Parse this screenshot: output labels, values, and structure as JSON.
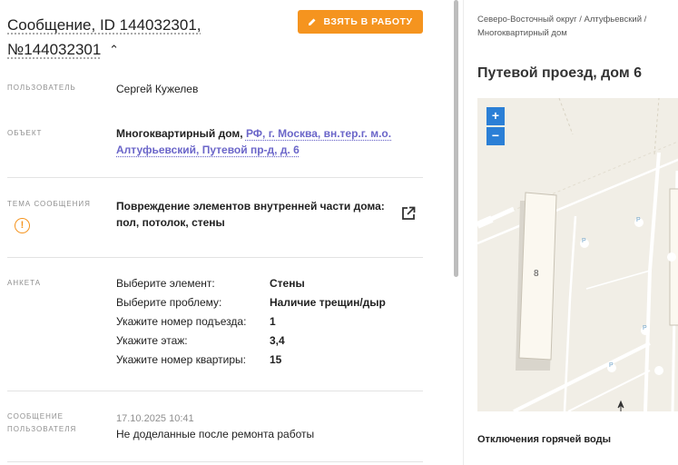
{
  "header": {
    "title_line1": "Сообщение, ID 144032301,",
    "title_line2": "№144032301",
    "chevron": "^",
    "take_button_label": "ВЗЯТЬ В РАБОТУ"
  },
  "fields": {
    "user_label": "ПОЛЬЗОВАТЕЛЬ",
    "user_value": "Сергей Кужелев",
    "object_label": "ОБЪЕКТ",
    "object_prefix": "Многоквартирный дом,",
    "object_link_line1": "РФ, г. Москва, вн.тер.г. м.о.",
    "object_link_line2": "Алтуфьевский, Путевой пр-д, д. 6",
    "topic_label": "ТЕМА СООБЩЕНИЯ",
    "topic_line1": "Повреждение элементов внутренней части дома:",
    "topic_line2": "пол, потолок, стены",
    "form_label": "АНКЕТА",
    "form_rows": [
      {
        "k": "Выберите элемент:",
        "v": "Стены"
      },
      {
        "k": "Выберите проблему:",
        "v": "Наличие трещин/дыр"
      },
      {
        "k": "Укажите номер подъезда:",
        "v": "1"
      },
      {
        "k": "Укажите этаж:",
        "v": "3,4"
      },
      {
        "k": "Укажите номер квартиры:",
        "v": "15"
      }
    ],
    "message_label_line1": "СООБЩЕНИЕ",
    "message_label_line2": "ПОЛЬЗОВАТЕЛЯ",
    "message_date": "17.10.2025 10:41",
    "message_text": "Не доделанные после ремонта работы"
  },
  "right": {
    "breadcrumb_line1": "Северо-Восточный округ / Алтуфьевский /",
    "breadcrumb_line2": "Многоквартирный дом",
    "address": "Путевой проезд, дом 6",
    "zoom_in": "+",
    "zoom_out": "−",
    "building_number": "8",
    "parking_marker": "P",
    "section_title": "Отключения горячей воды"
  },
  "colors": {
    "accent_orange": "#f5941f",
    "link_purple": "#6b66c9",
    "map_zoom_blue": "#2b7fd6"
  }
}
